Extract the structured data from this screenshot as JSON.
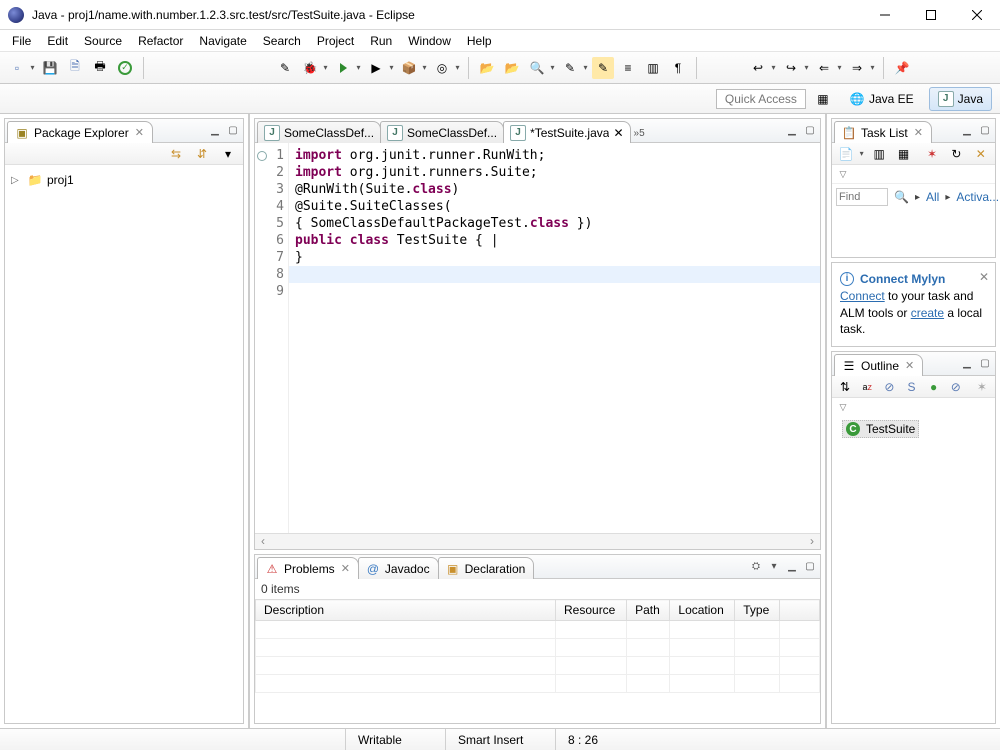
{
  "window": {
    "title": "Java - proj1/name.with.number.1.2.3.src.test/src/TestSuite.java - Eclipse"
  },
  "menu": [
    "File",
    "Edit",
    "Source",
    "Refactor",
    "Navigate",
    "Search",
    "Project",
    "Run",
    "Window",
    "Help"
  ],
  "quick_access": {
    "placeholder": "Quick Access"
  },
  "perspectives": {
    "java_ee": "Java EE",
    "java": "Java"
  },
  "package_explorer": {
    "title": "Package Explorer",
    "project": "proj1"
  },
  "editor": {
    "tabs": [
      {
        "label": "SomeClassDef...",
        "active": false
      },
      {
        "label": "SomeClassDef...",
        "active": false
      },
      {
        "label": "*TestSuite.java",
        "active": true
      }
    ],
    "overflow": "»5",
    "lines": [
      {
        "n": 1,
        "tokens": [
          [
            "kw",
            "import"
          ],
          [
            "",
            " org.junit.runner.RunWith;"
          ]
        ]
      },
      {
        "n": 2,
        "tokens": [
          [
            "kw",
            "import"
          ],
          [
            "",
            " org.junit.runners.Suite;"
          ]
        ]
      },
      {
        "n": 3,
        "tokens": [
          [
            "",
            ""
          ]
        ]
      },
      {
        "n": 4,
        "tokens": [
          [
            "",
            "@RunWith(Suite."
          ],
          [
            "kw",
            "class"
          ],
          [
            "",
            ")"
          ]
        ]
      },
      {
        "n": 5,
        "tokens": [
          [
            "",
            "@Suite.SuiteClasses("
          ]
        ]
      },
      {
        "n": 6,
        "tokens": [
          [
            "",
            ""
          ]
        ]
      },
      {
        "n": 7,
        "tokens": [
          [
            "",
            "{ SomeClassDefaultPackageTest."
          ],
          [
            "kw",
            "class"
          ],
          [
            "",
            " })"
          ]
        ]
      },
      {
        "n": 8,
        "tokens": [
          [
            "kw",
            "public"
          ],
          [
            "",
            " "
          ],
          [
            "kw",
            "class"
          ],
          [
            "",
            " TestSuite { "
          ]
        ],
        "highlight": true,
        "cursor": true
      },
      {
        "n": 9,
        "tokens": [
          [
            "",
            "}"
          ]
        ]
      }
    ]
  },
  "task_list": {
    "title": "Task List",
    "find": "Find",
    "all": "All",
    "activate": "Activa..."
  },
  "mylyn": {
    "title": "Connect Mylyn",
    "body_pre": " to your task and ALM tools or ",
    "body_post": " a local task.",
    "link_connect": "Connect",
    "link_create": "create"
  },
  "outline": {
    "title": "Outline",
    "item": "TestSuite"
  },
  "problems": {
    "tabs": {
      "problems": "Problems",
      "javadoc": "Javadoc",
      "declaration": "Declaration"
    },
    "items_label": "0 items",
    "cols": [
      "Description",
      "Resource",
      "Path",
      "Location",
      "Type"
    ]
  },
  "status": {
    "writable": "Writable",
    "insert": "Smart Insert",
    "pos": "8 : 26"
  }
}
